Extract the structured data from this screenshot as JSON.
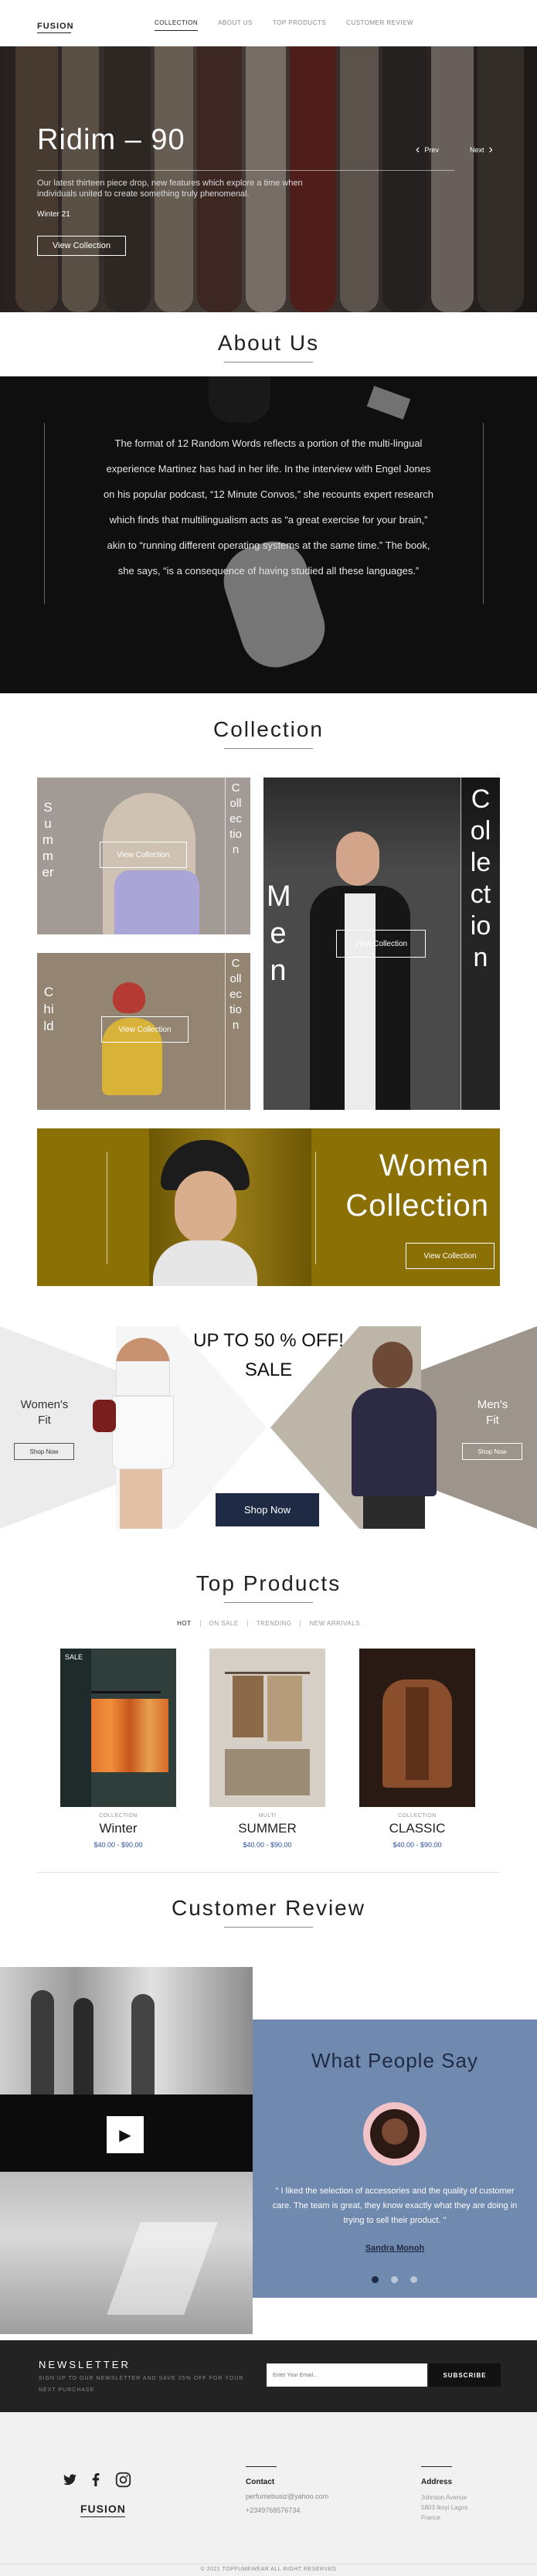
{
  "header": {
    "logo": "FUSION",
    "nav": [
      "COLLECTION",
      "ABOUT US",
      "TOP PRODUCTS",
      "CUSTOMER REVIEW"
    ]
  },
  "hero": {
    "title": "Ridim – 90",
    "subtitle": "Our latest thirteen piece drop, new features which explore a time when individuals united to create something truly phenomenal.",
    "date": "Winter 21",
    "cta": "View Collection",
    "prev": "Prev",
    "next": "Next"
  },
  "about": {
    "title": "About Us",
    "text": "The format of 12 Random Words reflects a portion of the multi-lingual experience Martinez has had in her life. In the interview with Engel Jones on his popular podcast, “12 Minute Convos,” she recounts expert research which finds that multilingualism acts as “a great exercise for your brain,” akin to “running different operating systems at the same time.” The book, she says, “is a consequence of having studied all these languages.”"
  },
  "collection": {
    "title": "Collection",
    "summer": {
      "label": "Summer",
      "side": "Collection",
      "cta": "View Collection"
    },
    "child": {
      "label": "Child",
      "side": "Collection",
      "cta": "View Collection"
    },
    "men": {
      "label": "Men",
      "side": "Collection",
      "cta": "View Collection"
    },
    "women": {
      "line1": "Women",
      "line2": "Collection",
      "cta": "View Collection"
    }
  },
  "sale": {
    "headline1": "UP TO 50 % OFF!",
    "headline2": "SALE",
    "women_label1": "Women's",
    "women_label2": "Fit",
    "women_cta": "Shop Now",
    "men_label1": "Men's",
    "men_label2": "Fit",
    "men_cta": "Shop Now",
    "shop_now": "Shop Now"
  },
  "products": {
    "title": "Top Products",
    "tabs": [
      "HOT",
      "ON SALE",
      "TRENDING",
      "NEW ARRIVALS"
    ],
    "items": [
      {
        "badge": "SALE",
        "category": "COLLECTION",
        "name": "Winter",
        "price": "$40.00 - $90.00"
      },
      {
        "badge": "",
        "category": "MULTI",
        "name": "SUMMER",
        "price": "$40.00 - $90.00"
      },
      {
        "badge": "",
        "category": "COLLECTION",
        "name": "CLASSIC",
        "price": "$40.00 - $90.00"
      }
    ]
  },
  "review": {
    "title": "Customer Review",
    "panel_title": "What People Say",
    "quote": "\" I liked the selection of accessories and the quality of customer care. The team is great, they know exactly what they are doing in trying to sell their product. \"",
    "author": "Sandra Monoh"
  },
  "newsletter": {
    "title": "NEWSLETTER",
    "text": "SIGN UP TO OUR NEWSLETTER AND SAVE 25% OFF FOR YOUR NEXT PURCHASE",
    "placeholder": "Enter Your Email...",
    "button": "SUBSCRIBE"
  },
  "footer": {
    "logo": "FUSION",
    "contact_title": "Contact",
    "email": "perfumebusiz@yahoo.com",
    "phone": "+2349768576734",
    "address_title": "Address",
    "address": [
      "Johnson Avenue",
      "5803 Ikoyi Lagos",
      "France"
    ],
    "copyright": "2021 TOPFUMEWEAR ALL RIGHT RESERVED"
  },
  "colors": {
    "review_panel": "#7089ae",
    "women_banner": "#8b7006",
    "shop_now": "#1f2a44",
    "price": "#2b4f9e"
  },
  "icons": [
    "chevron-left-icon",
    "chevron-right-icon",
    "play-icon",
    "twitter-icon",
    "facebook-icon",
    "instagram-icon",
    "copyright-icon"
  ]
}
